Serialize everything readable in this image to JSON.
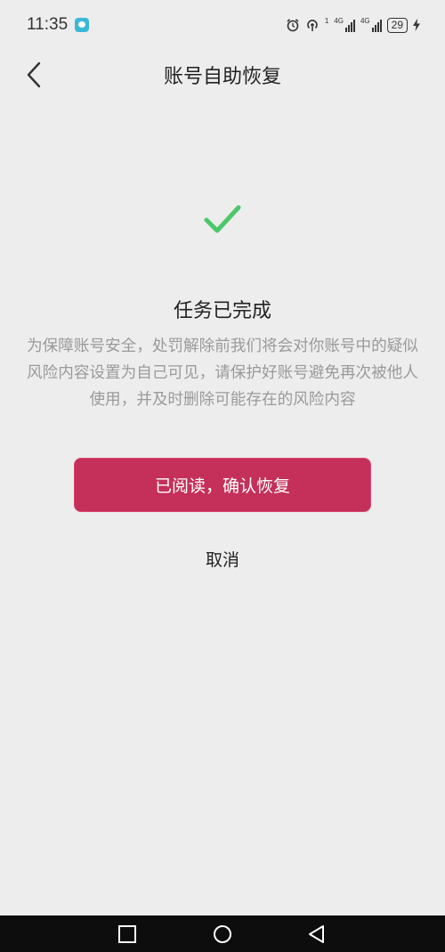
{
  "status_bar": {
    "time": "11:35",
    "network_1": "4G",
    "network_2": "4G",
    "superscript": "1",
    "battery": "29"
  },
  "header": {
    "title": "账号自助恢复"
  },
  "result": {
    "title": "任务已完成",
    "description": "为保障账号安全，处罚解除前我们将会对你账号中的疑似风险内容设置为自己可见，请保护好账号避免再次被他人使用，并及时删除可能存在的风险内容"
  },
  "actions": {
    "confirm_label": "已阅读，确认恢复",
    "cancel_label": "取消"
  },
  "colors": {
    "accent": "#c4305a",
    "check": "#4cc86a",
    "background": "#ededed"
  },
  "icons": {
    "back": "chevron-left-icon",
    "success": "check-icon",
    "nav_recent": "square-icon",
    "nav_home": "circle-icon",
    "nav_back": "triangle-back-icon"
  }
}
